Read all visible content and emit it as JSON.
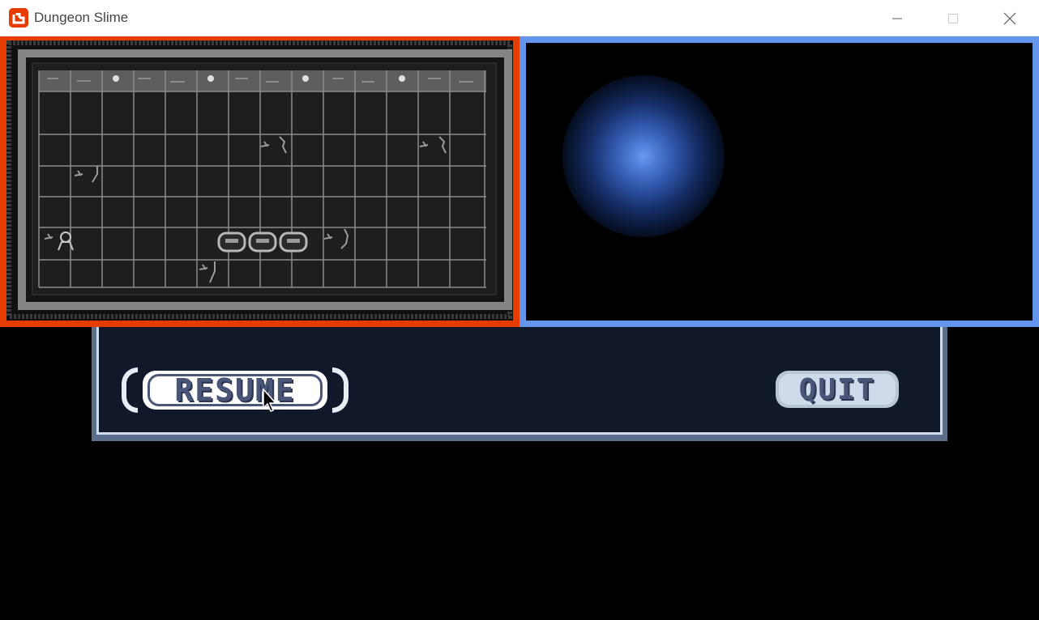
{
  "window": {
    "title": "Dungeon Slime",
    "icon": "monogame-logo-icon",
    "controls": [
      "minimize-icon",
      "maximize-icon",
      "close-icon"
    ]
  },
  "viewports": {
    "left": {
      "border_color": "#e73c00",
      "content": "dungeon-room-tilemap"
    },
    "right": {
      "border_color": "#6495ed",
      "content": "blue-light-glow"
    }
  },
  "pause_menu": {
    "resume_label": "RESUME",
    "quit_label": "QUIT",
    "panel_color": "#111829",
    "text_color": "#4a5578"
  }
}
